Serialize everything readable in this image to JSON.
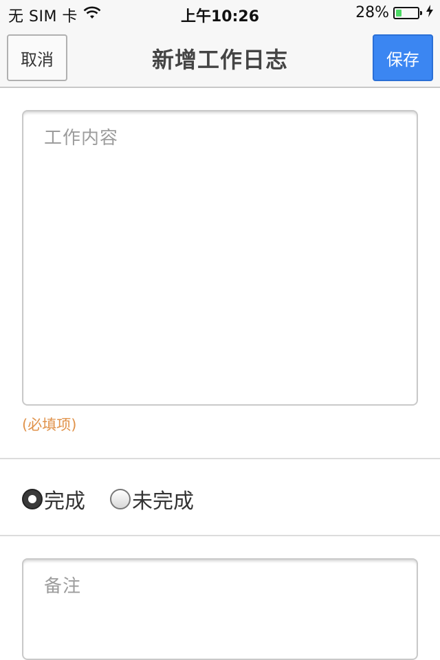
{
  "status_bar": {
    "carrier": "无 SIM 卡",
    "wifi_icon": "wifi-icon",
    "time": "上午10:26",
    "battery_percent": "28%",
    "battery_level": 0.28,
    "battery_color": "#4cd964",
    "charging_icon": "bolt-icon"
  },
  "nav": {
    "cancel_label": "取消",
    "title": "新增工作日志",
    "save_label": "保存",
    "save_color": "#3b86f2"
  },
  "form": {
    "content_placeholder": "工作内容",
    "content_value": "",
    "required_note": "(必填项)",
    "status_options": [
      {
        "label": "完成",
        "checked": true
      },
      {
        "label": "未完成",
        "checked": false
      }
    ],
    "remark_placeholder": "备注",
    "remark_value": ""
  }
}
